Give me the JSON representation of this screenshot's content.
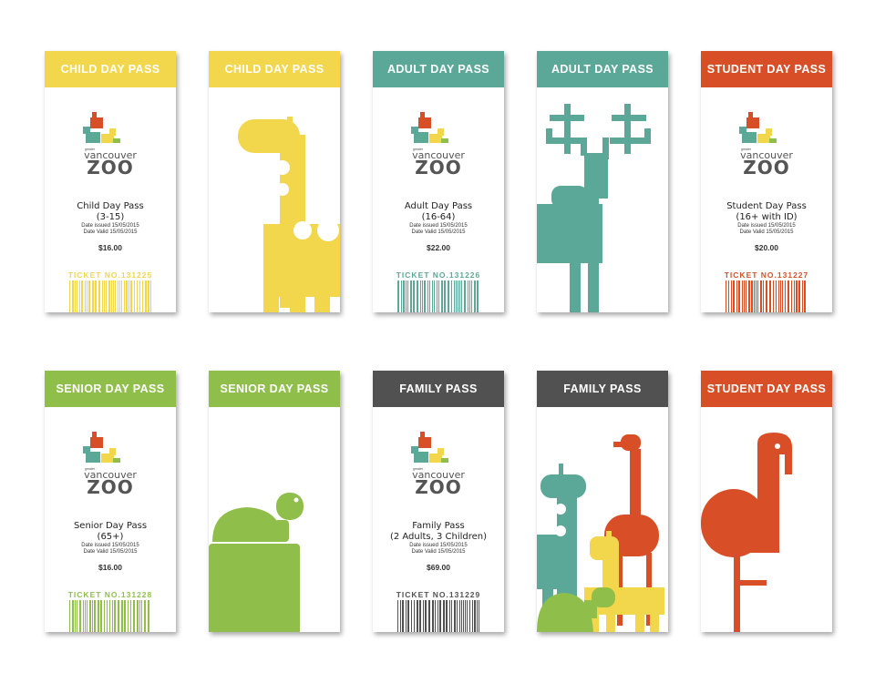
{
  "colors": {
    "yellow": "#f2d64b",
    "teal": "#5ba898",
    "orange": "#d84f27",
    "green": "#8fbf4a",
    "dark": "#505150"
  },
  "logo": {
    "small_text": "greater",
    "line1": "vancouver",
    "line2": "ZOO"
  },
  "tickets": [
    {
      "header": "CHILD DAY PASS",
      "name": "Child Day Pass",
      "range": "(3-15)",
      "date_issued": "Date issued 15/05/2015",
      "date_valid": "Date Valid 15/05/2015",
      "price": "$16.00",
      "ticket_no": "TICKET NO.131225"
    },
    {
      "header": "ADULT DAY PASS",
      "name": "Adult Day Pass",
      "range": "(16-64)",
      "date_issued": "Date issued 15/05/2015",
      "date_valid": "Date Valid 15/05/2015",
      "price": "$22.00",
      "ticket_no": "TICKET NO.131226"
    },
    {
      "header": "STUDENT DAY PASS",
      "name": "Student Day Pass",
      "range": "(16+ with ID)",
      "date_issued": "Date issued 15/05/2015",
      "date_valid": "Date Valid 15/05/2015",
      "price": "$20.00",
      "ticket_no": "TICKET NO.131227"
    },
    {
      "header": "SENIOR DAY PASS",
      "name": "Senior Day Pass",
      "range": "(65+)",
      "date_issued": "Date issued 15/05/2015",
      "date_valid": "Date Valid 15/05/2015",
      "price": "$16.00",
      "ticket_no": "TICKET NO.131228"
    },
    {
      "header": "FAMILY PASS",
      "name": "Family Pass",
      "range": "(2 Adults, 3 Children)",
      "date_issued": "Date issued 15/05/2015",
      "date_valid": "Date Valid 15/05/2015",
      "price": "$69.00",
      "ticket_no": "TICKET NO.131229"
    }
  ],
  "art_cards": [
    {
      "header": "CHILD DAY PASS",
      "animal": "giraffe-icon"
    },
    {
      "header": "ADULT DAY PASS",
      "animal": "moose-icon"
    },
    {
      "header": "SENIOR DAY PASS",
      "animal": "turtle-icon"
    },
    {
      "header": "FAMILY PASS",
      "animal": "animal-family-icon"
    },
    {
      "header": "STUDENT DAY PASS",
      "animal": "flamingo-icon"
    }
  ]
}
